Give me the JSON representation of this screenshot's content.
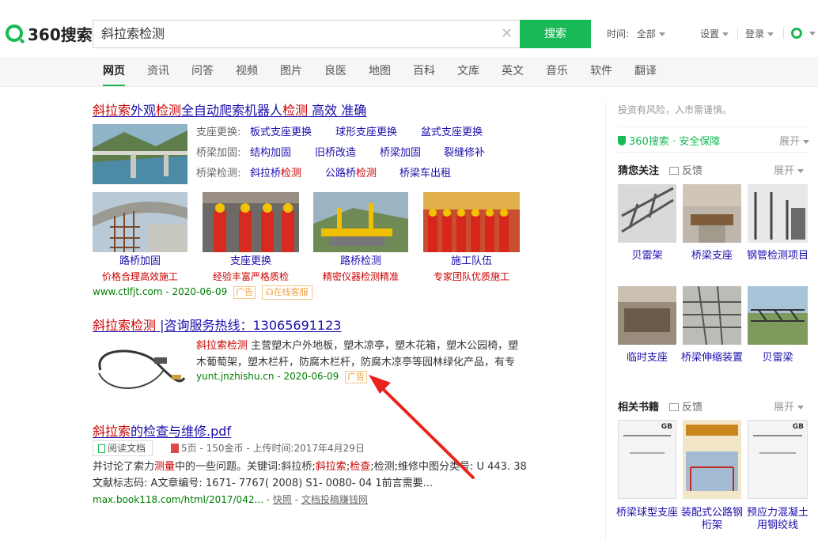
{
  "header": {
    "logo_text": "360搜索",
    "search_value": "斜拉索检测",
    "clear_icon": "close-icon",
    "search_button": "搜索",
    "time_label": "时间:",
    "time_value": "全部",
    "settings": "设置",
    "login": "登录",
    "brand_color": "#19b955"
  },
  "tabs": [
    "网页",
    "资讯",
    "问答",
    "视频",
    "图片",
    "良医",
    "地图",
    "百科",
    "文库",
    "英文",
    "音乐",
    "软件",
    "翻译"
  ],
  "result1": {
    "title_hl1": "斜拉索",
    "title_mid1": "外观",
    "title_hl2": "检测",
    "title_mid2": "全自动爬索机器人",
    "title_hl3": "检测",
    "title_tail": " 高效 准确",
    "rows": [
      {
        "label": "支座更换:",
        "links": [
          "板式支座更换",
          "球形支座更换",
          "盆式支座更换"
        ]
      },
      {
        "label": "桥梁加固:",
        "links": [
          "结构加固",
          "旧桥改造",
          "桥梁加固",
          "裂缝修补"
        ]
      },
      {
        "label": "桥梁检测:",
        "links": [
          "斜拉桥检测",
          "公路桥检测",
          "桥梁车出租"
        ]
      }
    ],
    "tiles": [
      {
        "title": "路桥加固",
        "desc": "价格合理高效施工"
      },
      {
        "title": "支座更换",
        "desc": "经验丰富严格质检"
      },
      {
        "title": "路桥检测",
        "desc": "精密仪器检测精准"
      },
      {
        "title": "施工队伍",
        "desc": "专家团队优质施工"
      }
    ],
    "url": "www.ctlfjt.com",
    "date": "2020-06-09",
    "ad": "广告",
    "online": "在线客服"
  },
  "result2": {
    "title_hl": "斜拉索检测",
    "title_tail": " |咨询服务热线：13065691123",
    "desc_hl": "斜拉索检测",
    "desc_line1": " 主营塑木户外地板，塑木凉亭，塑木花箱，塑木公园椅，塑",
    "desc_line2": "木葡萄架，塑木栏杆，防腐木栏杆，防腐木凉亭等园林绿化产品，有专",
    "url": "yunt.jnzhishu.cn",
    "date": "2020-06-09",
    "ad": "广告"
  },
  "result3": {
    "title_hl": "斜拉索",
    "title_tail": "的检查与维修.pdf",
    "read_button": "阅读文档",
    "meta": "5页 - 150金币 - 上传时间:2017年4月29日",
    "line1_a": "并讨论了索力",
    "line1_hl": "测量",
    "line1_b": "中的一些问题。关键词:斜拉桥;",
    "line1_hl2": "斜拉索",
    "line1_c": ";",
    "line1_hl3": "检查",
    "line1_d": ";检测;维修中图分类号: U 443. 38",
    "line2": "文献标志码: A文章编号: 1671- 7767( 2008) S1- 0080- 04 1前言需要...",
    "url": "max.book118.com/html/2017/042...",
    "snapshot": "快照",
    "earn": "文档投稿赚钱网"
  },
  "right": {
    "notice": "投资有风险，入市需谨慎。",
    "safe": "360搜索 · 安全保障",
    "expand": "展开",
    "guess_title": "猜您关注",
    "feedback": "反馈",
    "guess": [
      "贝雷架",
      "桥梁支座",
      "钢管检测项目",
      "临时支座",
      "桥梁伸缩装置",
      "贝雷梁"
    ],
    "books_title": "相关书籍",
    "books": [
      "桥梁球型支座",
      "装配式公路钢桁架",
      "预应力混凝土用钢绞线"
    ],
    "book_badge": "GB"
  }
}
